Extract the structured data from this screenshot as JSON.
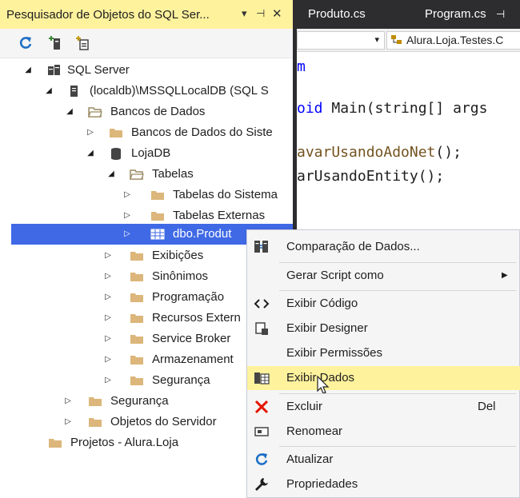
{
  "explorer": {
    "title": "Pesquisador de Objetos do SQL Ser...",
    "title_controls": [
      "▾",
      "⊣",
      "✕"
    ],
    "tree": [
      {
        "label": "SQL Server",
        "expander": "◢",
        "icon": "server-group-icon"
      },
      {
        "label": "(localdb)\\MSSQLLocalDB (SQL S",
        "expander": "◢",
        "icon": "server-icon"
      },
      {
        "label": "Bancos de Dados",
        "expander": "◢",
        "icon": "folder-open-icon"
      },
      {
        "label": "Bancos de Dados do Siste",
        "expander": "▷",
        "icon": "folder-icon"
      },
      {
        "label": "LojaDB",
        "expander": "◢",
        "icon": "database-icon"
      },
      {
        "label": "Tabelas",
        "expander": "◢",
        "icon": "folder-open-icon"
      },
      {
        "label": "Tabelas do Sistema",
        "expander": "▷",
        "icon": "folder-icon"
      },
      {
        "label": "Tabelas Externas",
        "expander": "▷",
        "icon": "folder-icon"
      },
      {
        "label": "dbo.Produt",
        "expander": "▷",
        "icon": "table-icon"
      },
      {
        "label": "Exibições",
        "expander": "▷",
        "icon": "folder-icon"
      },
      {
        "label": "Sinônimos",
        "expander": "▷",
        "icon": "folder-icon"
      },
      {
        "label": "Programação",
        "expander": "▷",
        "icon": "folder-icon"
      },
      {
        "label": "Recursos Extern",
        "expander": "▷",
        "icon": "folder-icon"
      },
      {
        "label": "Service Broker",
        "expander": "▷",
        "icon": "folder-icon"
      },
      {
        "label": "Armazenament",
        "expander": "▷",
        "icon": "folder-icon"
      },
      {
        "label": "Segurança",
        "expander": "▷",
        "icon": "folder-icon"
      },
      {
        "label": "Segurança",
        "expander": "▷",
        "icon": "folder-icon"
      },
      {
        "label": "Objetos do Servidor",
        "expander": "▷",
        "icon": "folder-icon"
      },
      {
        "label": "Projetos - Alura.Loja",
        "expander": "",
        "icon": "folder-icon"
      }
    ]
  },
  "editor": {
    "tabs": [
      {
        "label": "Produto.cs",
        "pin": ""
      },
      {
        "label": "Program.cs",
        "pin": "⊣"
      }
    ],
    "nav_dropdown_arrow": "▾",
    "nav_right": "Alura.Loja.Testes.C",
    "code_lines": [
      {
        "prefix": "m",
        "rest": "",
        "prefix_color": "#0000ff"
      },
      {
        "prefix": "oid",
        "rest": " Main(string[] args",
        "prefix_color": "#0000ff"
      },
      {
        "prefix": "avarUsandoAdoNet",
        "rest": "();",
        "prefix_color": "#74531f"
      },
      {
        "prefix": "arUsandoEntity",
        "rest": "();",
        "prefix_color": "#1e1e1e"
      }
    ]
  },
  "context_menu": {
    "items": [
      {
        "label": "Comparação de Dados...",
        "icon": "data-compare-icon",
        "shortcut": "",
        "submenu": false
      },
      {
        "label": "Gerar Script como",
        "icon": "",
        "shortcut": "",
        "submenu": true,
        "arrow": "▶"
      },
      {
        "label": "Exibir Código",
        "icon": "code-icon",
        "shortcut": "",
        "submenu": false
      },
      {
        "label": "Exibir Designer",
        "icon": "designer-icon",
        "shortcut": "",
        "submenu": false
      },
      {
        "label": "Exibir Permissões",
        "icon": "",
        "shortcut": "",
        "submenu": false
      },
      {
        "label": "Exibir Dados",
        "icon": "view-data-icon",
        "shortcut": "",
        "submenu": false
      },
      {
        "label": "Excluir",
        "icon": "delete-icon",
        "shortcut": "Del",
        "submenu": false
      },
      {
        "label": "Renomear",
        "icon": "rename-icon",
        "shortcut": "",
        "submenu": false
      },
      {
        "label": "Atualizar",
        "icon": "refresh-icon",
        "shortcut": "",
        "submenu": false
      },
      {
        "label": "Propriedades",
        "icon": "wrench-icon",
        "shortcut": "",
        "submenu": false
      }
    ]
  },
  "colors": {
    "title_highlight": "#fff29d",
    "selection": "#3f69e5",
    "menu_highlight": "#fff29d",
    "delete_red": "#e51400",
    "refresh_blue": "#1f6fc5",
    "folder": "#dcb67a"
  }
}
